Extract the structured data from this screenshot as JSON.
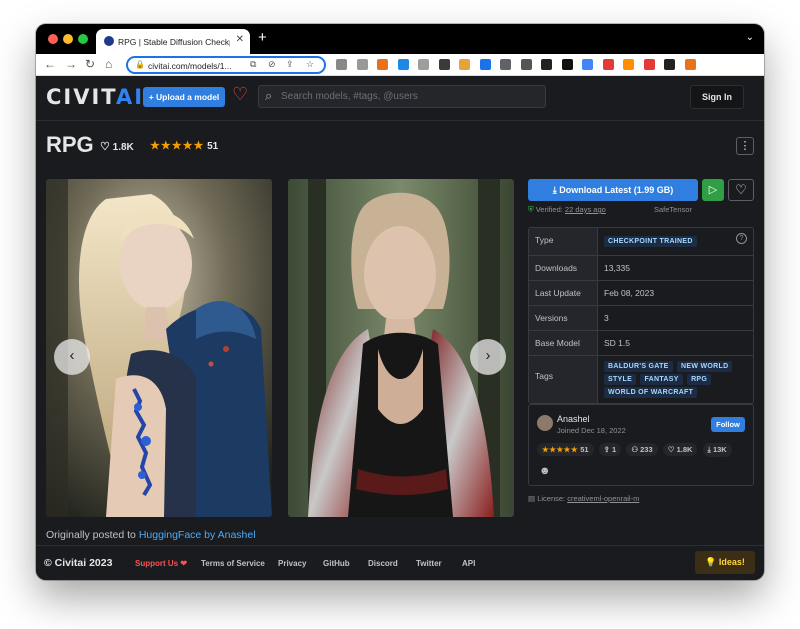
{
  "browser": {
    "tab_title": "RPG | Stable Diffusion Checkpo",
    "tab_close": "✕",
    "new_tab": "+",
    "tab_menu": "⌄",
    "url": "civitai.com/models/1...",
    "ext_colors": [
      "#888888",
      "#999999",
      "#e8711a",
      "#1e88e5",
      "#9e9e9e",
      "#3a3a3a",
      "#e8a23a",
      "#1a73e8",
      "#5f6368",
      "#555555",
      "#222222",
      "#111111",
      "#4285f4",
      "#e53935",
      "#ff8f00",
      "#e53935",
      "#222222",
      "#e8711a"
    ]
  },
  "site": {
    "logo_main": "CIVIT",
    "logo_ai": "AI",
    "upload_label": "+ Upload a model",
    "search_placeholder": "Search models, #tags, @users",
    "signin_label": "Sign In"
  },
  "model": {
    "title": "RPG",
    "likes": "1.8K",
    "stars": "★★★★★",
    "rating_count": "51",
    "more": "⋮"
  },
  "gallery": {
    "prev": "‹",
    "next": "›",
    "originally_posted": "Originally posted to ",
    "origin_link": "HuggingFace by Anashel"
  },
  "download": {
    "label": "Download Latest (1.99 GB)",
    "verified_text": "Verified:",
    "verified_when": "22 days ago",
    "safetensor": "SafeTensor"
  },
  "details": {
    "rows": [
      {
        "key": "Type",
        "value": "CHECKPOINT TRAINED"
      },
      {
        "key": "Downloads",
        "value": "13,335"
      },
      {
        "key": "Last Update",
        "value": "Feb 08, 2023"
      },
      {
        "key": "Versions",
        "value": "3"
      },
      {
        "key": "Base Model",
        "value": "SD 1.5"
      }
    ],
    "tags_label": "Tags",
    "tags": [
      "BALDUR'S GATE",
      "NEW WORLD",
      "STYLE",
      "FANTASY",
      "RPG",
      "WORLD OF WARCRAFT"
    ]
  },
  "creator": {
    "name": "Anashel",
    "joined": "Joined Dec 18, 2022",
    "follow_label": "Follow",
    "stars": "★★★★★",
    "rating": "51",
    "uploads": "1",
    "followers": "233",
    "likes": "1.8K",
    "downloads": "13K"
  },
  "license": {
    "label": "License:",
    "name": "creativeml-openrail-m"
  },
  "footer": {
    "copyright": "© Civitai 2023",
    "support": "Support Us ❤",
    "terms": "Terms of Service",
    "privacy": "Privacy",
    "github": "GitHub",
    "discord": "Discord",
    "twitter": "Twitter",
    "api": "API",
    "ideas": "💡 Ideas!"
  }
}
